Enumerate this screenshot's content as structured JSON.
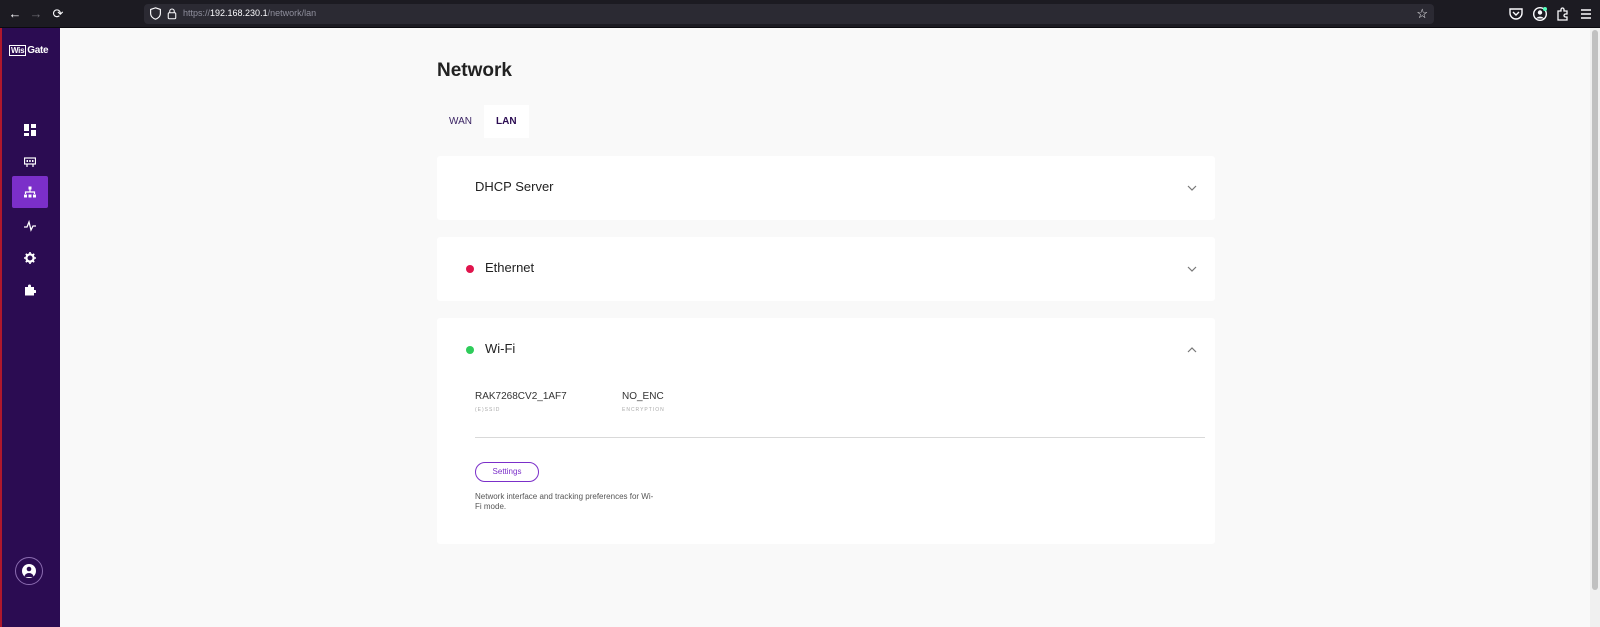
{
  "browser": {
    "url_scheme": "https://",
    "url_host": "192.168.230.1",
    "url_path": "/network/lan",
    "back_icon": "←",
    "forward_icon": "→",
    "reload_icon": "⟳",
    "star_icon": "☆"
  },
  "sidebar": {
    "logo_box": "Wis",
    "logo_text": "Gate",
    "items": [
      {
        "icon": "dashboard-icon"
      },
      {
        "icon": "gateway-icon"
      },
      {
        "icon": "network-icon",
        "active": true
      },
      {
        "icon": "activity-icon"
      },
      {
        "icon": "settings-gear-icon"
      },
      {
        "icon": "extensions-icon"
      }
    ],
    "avatar_icon": "user-icon",
    "accent_color": "#7b2fc9",
    "background_color": "#2b0c52"
  },
  "main": {
    "title": "Network",
    "tabs": [
      {
        "label": "WAN",
        "active": false
      },
      {
        "label": "LAN",
        "active": true
      }
    ],
    "cards": {
      "dhcp": {
        "title": "DHCP Server",
        "expanded": false
      },
      "ethernet": {
        "title": "Ethernet",
        "status_color": "#e0144c",
        "expanded": false
      },
      "wifi": {
        "title": "Wi-Fi",
        "status_color": "#2ecc5a",
        "expanded": true,
        "ssid_value": "RAK7268CV2_1AF7",
        "ssid_caption": "(E)SSID",
        "encryption_value": "NO_ENC",
        "encryption_caption": "ENCRYPTION",
        "settings_label": "Settings",
        "description": "Network interface and tracking preferences for Wi-Fi mode."
      }
    }
  }
}
